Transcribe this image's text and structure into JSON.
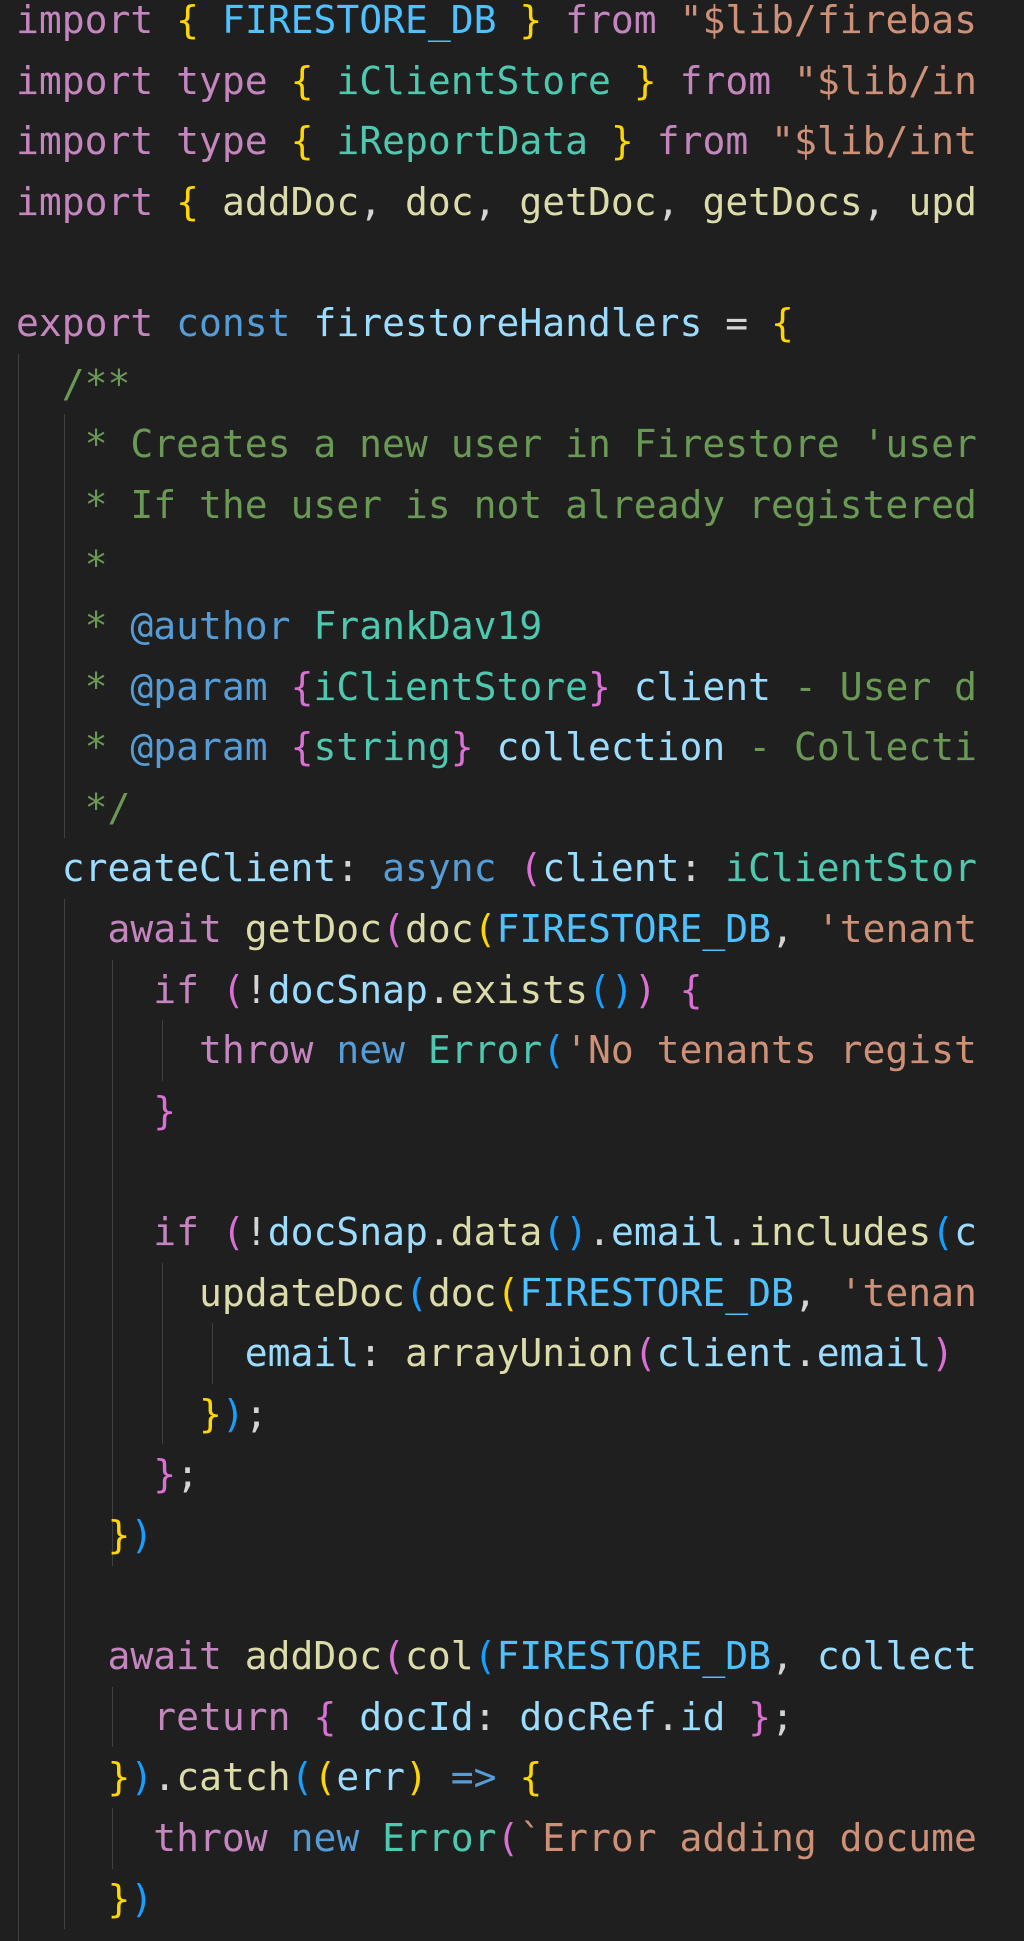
{
  "editor": {
    "colors": {
      "background": "#1f1f1f",
      "keyword": "#c586c0",
      "storage": "#569cd6",
      "function": "#dcdcaa",
      "string": "#ce9178",
      "variable": "#9cdcfe",
      "constant": "#4fc1ff",
      "type": "#4ec9b0",
      "comment": "#6a9955",
      "bracket_1": "#ffd700",
      "bracket_2": "#da70d6",
      "bracket_3": "#179fff"
    },
    "lines": [
      [
        {
          "t": "import",
          "c": "kw"
        },
        {
          "t": " "
        },
        {
          "t": "{",
          "c": "b1"
        },
        {
          "t": " "
        },
        {
          "t": "FIRESTORE_DB",
          "c": "const"
        },
        {
          "t": " "
        },
        {
          "t": "}",
          "c": "b1"
        },
        {
          "t": " "
        },
        {
          "t": "from",
          "c": "kw"
        },
        {
          "t": " "
        },
        {
          "t": "\"$lib/firebas",
          "c": "str"
        }
      ],
      [
        {
          "t": "import",
          "c": "kw"
        },
        {
          "t": " "
        },
        {
          "t": "type",
          "c": "kw"
        },
        {
          "t": " "
        },
        {
          "t": "{",
          "c": "b1"
        },
        {
          "t": " "
        },
        {
          "t": "iClientStore",
          "c": "type"
        },
        {
          "t": " "
        },
        {
          "t": "}",
          "c": "b1"
        },
        {
          "t": " "
        },
        {
          "t": "from",
          "c": "kw"
        },
        {
          "t": " "
        },
        {
          "t": "\"$lib/in",
          "c": "str"
        }
      ],
      [
        {
          "t": "import",
          "c": "kw"
        },
        {
          "t": " "
        },
        {
          "t": "type",
          "c": "kw"
        },
        {
          "t": " "
        },
        {
          "t": "{",
          "c": "b1"
        },
        {
          "t": " "
        },
        {
          "t": "iReportData",
          "c": "type"
        },
        {
          "t": " "
        },
        {
          "t": "}",
          "c": "b1"
        },
        {
          "t": " "
        },
        {
          "t": "from",
          "c": "kw"
        },
        {
          "t": " "
        },
        {
          "t": "\"$lib/int",
          "c": "str"
        }
      ],
      [
        {
          "t": "import",
          "c": "kw"
        },
        {
          "t": " "
        },
        {
          "t": "{",
          "c": "b1"
        },
        {
          "t": " "
        },
        {
          "t": "addDoc",
          "c": "fn"
        },
        {
          "t": ", ",
          "c": "p"
        },
        {
          "t": "doc",
          "c": "fn"
        },
        {
          "t": ", ",
          "c": "p"
        },
        {
          "t": "getDoc",
          "c": "fn"
        },
        {
          "t": ", ",
          "c": "p"
        },
        {
          "t": "getDocs",
          "c": "fn"
        },
        {
          "t": ", ",
          "c": "p"
        },
        {
          "t": "upd",
          "c": "fn"
        }
      ],
      [],
      [
        {
          "t": "export",
          "c": "kw"
        },
        {
          "t": " "
        },
        {
          "t": "const",
          "c": "kw2"
        },
        {
          "t": " "
        },
        {
          "t": "firestoreHandlers",
          "c": "var"
        },
        {
          "t": " = ",
          "c": "p"
        },
        {
          "t": "{",
          "c": "b1"
        }
      ],
      [
        {
          "t": "  "
        },
        {
          "t": "/**",
          "c": "com"
        }
      ],
      [
        {
          "t": "   "
        },
        {
          "t": "* Creates a new user in Firestore 'user",
          "c": "com"
        }
      ],
      [
        {
          "t": "   "
        },
        {
          "t": "* If the user is not already registered",
          "c": "com"
        }
      ],
      [
        {
          "t": "   "
        },
        {
          "t": "*",
          "c": "com"
        }
      ],
      [
        {
          "t": "   "
        },
        {
          "t": "* ",
          "c": "com"
        },
        {
          "t": "@author",
          "c": "kw2"
        },
        {
          "t": " "
        },
        {
          "t": "FrankDav19",
          "c": "type"
        }
      ],
      [
        {
          "t": "   "
        },
        {
          "t": "* ",
          "c": "com"
        },
        {
          "t": "@param",
          "c": "kw2"
        },
        {
          "t": " "
        },
        {
          "t": "{",
          "c": "b2"
        },
        {
          "t": "iClientStore",
          "c": "type"
        },
        {
          "t": "}",
          "c": "b2"
        },
        {
          "t": " "
        },
        {
          "t": "client",
          "c": "var"
        },
        {
          "t": " - User d",
          "c": "com"
        }
      ],
      [
        {
          "t": "   "
        },
        {
          "t": "* ",
          "c": "com"
        },
        {
          "t": "@param",
          "c": "kw2"
        },
        {
          "t": " "
        },
        {
          "t": "{",
          "c": "b2"
        },
        {
          "t": "string",
          "c": "type"
        },
        {
          "t": "}",
          "c": "b2"
        },
        {
          "t": " "
        },
        {
          "t": "collection",
          "c": "var"
        },
        {
          "t": " - Collecti",
          "c": "com"
        }
      ],
      [
        {
          "t": "   "
        },
        {
          "t": "*/",
          "c": "com"
        }
      ],
      [
        {
          "t": "  "
        },
        {
          "t": "createClient",
          "c": "var"
        },
        {
          "t": ": ",
          "c": "p"
        },
        {
          "t": "async",
          "c": "kw2"
        },
        {
          "t": " "
        },
        {
          "t": "(",
          "c": "b2"
        },
        {
          "t": "client",
          "c": "var"
        },
        {
          "t": ": ",
          "c": "p"
        },
        {
          "t": "iClientStor",
          "c": "type"
        }
      ],
      [
        {
          "t": "    "
        },
        {
          "t": "await",
          "c": "kw"
        },
        {
          "t": " "
        },
        {
          "t": "getDoc",
          "c": "fn"
        },
        {
          "t": "(",
          "c": "b2"
        },
        {
          "t": "doc",
          "c": "fn"
        },
        {
          "t": "(",
          "c": "b1"
        },
        {
          "t": "FIRESTORE_DB",
          "c": "const"
        },
        {
          "t": ", ",
          "c": "p"
        },
        {
          "t": "'tenant",
          "c": "str"
        }
      ],
      [
        {
          "t": "      "
        },
        {
          "t": "if",
          "c": "kw"
        },
        {
          "t": " "
        },
        {
          "t": "(",
          "c": "b2"
        },
        {
          "t": "!",
          "c": "p"
        },
        {
          "t": "docSnap",
          "c": "var"
        },
        {
          "t": ".",
          "c": "p"
        },
        {
          "t": "exists",
          "c": "fn"
        },
        {
          "t": "()",
          "c": "b3"
        },
        {
          "t": ")",
          "c": "b2"
        },
        {
          "t": " "
        },
        {
          "t": "{",
          "c": "b2"
        }
      ],
      [
        {
          "t": "        "
        },
        {
          "t": "throw",
          "c": "kw"
        },
        {
          "t": " "
        },
        {
          "t": "new",
          "c": "kw2"
        },
        {
          "t": " "
        },
        {
          "t": "Error",
          "c": "type"
        },
        {
          "t": "(",
          "c": "b3"
        },
        {
          "t": "'No tenants regist",
          "c": "str"
        }
      ],
      [
        {
          "t": "      "
        },
        {
          "t": "}",
          "c": "b2"
        }
      ],
      [],
      [
        {
          "t": "      "
        },
        {
          "t": "if",
          "c": "kw"
        },
        {
          "t": " "
        },
        {
          "t": "(",
          "c": "b2"
        },
        {
          "t": "!",
          "c": "p"
        },
        {
          "t": "docSnap",
          "c": "var"
        },
        {
          "t": ".",
          "c": "p"
        },
        {
          "t": "data",
          "c": "fn"
        },
        {
          "t": "()",
          "c": "b3"
        },
        {
          "t": ".",
          "c": "p"
        },
        {
          "t": "email",
          "c": "var"
        },
        {
          "t": ".",
          "c": "p"
        },
        {
          "t": "includes",
          "c": "fn"
        },
        {
          "t": "(",
          "c": "b3"
        },
        {
          "t": "c",
          "c": "var"
        }
      ],
      [
        {
          "t": "        "
        },
        {
          "t": "updateDoc",
          "c": "fn"
        },
        {
          "t": "(",
          "c": "b3"
        },
        {
          "t": "doc",
          "c": "fn"
        },
        {
          "t": "(",
          "c": "b1"
        },
        {
          "t": "FIRESTORE_DB",
          "c": "const"
        },
        {
          "t": ", ",
          "c": "p"
        },
        {
          "t": "'tenan",
          "c": "str"
        }
      ],
      [
        {
          "t": "          "
        },
        {
          "t": "email",
          "c": "var"
        },
        {
          "t": ": ",
          "c": "p"
        },
        {
          "t": "arrayUnion",
          "c": "fn"
        },
        {
          "t": "(",
          "c": "b2"
        },
        {
          "t": "client",
          "c": "var"
        },
        {
          "t": ".",
          "c": "p"
        },
        {
          "t": "email",
          "c": "var"
        },
        {
          "t": ")",
          "c": "b2"
        }
      ],
      [
        {
          "t": "        "
        },
        {
          "t": "}",
          "c": "b1"
        },
        {
          "t": ")",
          "c": "b3"
        },
        {
          "t": ";",
          "c": "p"
        }
      ],
      [
        {
          "t": "      "
        },
        {
          "t": "}",
          "c": "b2"
        },
        {
          "t": ";",
          "c": "p"
        }
      ],
      [
        {
          "t": "    "
        },
        {
          "t": "}",
          "c": "b1"
        },
        {
          "t": ")",
          "c": "b3"
        }
      ],
      [],
      [
        {
          "t": "    "
        },
        {
          "t": "await",
          "c": "kw"
        },
        {
          "t": " "
        },
        {
          "t": "addDoc",
          "c": "fn"
        },
        {
          "t": "(",
          "c": "b2"
        },
        {
          "t": "col",
          "c": "fn"
        },
        {
          "t": "(",
          "c": "b3"
        },
        {
          "t": "FIRESTORE_DB",
          "c": "const"
        },
        {
          "t": ", ",
          "c": "p"
        },
        {
          "t": "collect",
          "c": "var"
        }
      ],
      [
        {
          "t": "      "
        },
        {
          "t": "return",
          "c": "kw"
        },
        {
          "t": " "
        },
        {
          "t": "{",
          "c": "b2"
        },
        {
          "t": " "
        },
        {
          "t": "docId",
          "c": "var"
        },
        {
          "t": ": ",
          "c": "p"
        },
        {
          "t": "docRef",
          "c": "var"
        },
        {
          "t": ".",
          "c": "p"
        },
        {
          "t": "id",
          "c": "var"
        },
        {
          "t": " "
        },
        {
          "t": "}",
          "c": "b2"
        },
        {
          "t": ";",
          "c": "p"
        }
      ],
      [
        {
          "t": "    "
        },
        {
          "t": "}",
          "c": "b1"
        },
        {
          "t": ")",
          "c": "b3"
        },
        {
          "t": ".",
          "c": "p"
        },
        {
          "t": "catch",
          "c": "fn"
        },
        {
          "t": "(",
          "c": "b3"
        },
        {
          "t": "(",
          "c": "b1"
        },
        {
          "t": "err",
          "c": "var"
        },
        {
          "t": ")",
          "c": "b1"
        },
        {
          "t": " "
        },
        {
          "t": "=>",
          "c": "kw2"
        },
        {
          "t": " "
        },
        {
          "t": "{",
          "c": "b1"
        }
      ],
      [
        {
          "t": "      "
        },
        {
          "t": "throw",
          "c": "kw"
        },
        {
          "t": " "
        },
        {
          "t": "new",
          "c": "kw2"
        },
        {
          "t": " "
        },
        {
          "t": "Error",
          "c": "type"
        },
        {
          "t": "(",
          "c": "b2"
        },
        {
          "t": "`Error adding docume",
          "c": "str"
        }
      ],
      [
        {
          "t": "    "
        },
        {
          "t": "}",
          "c": "b1"
        },
        {
          "t": ")",
          "c": "b3"
        }
      ],
      [
        {
          "t": "  "
        },
        {
          "t": "}",
          "c": "b1"
        }
      ]
    ]
  }
}
